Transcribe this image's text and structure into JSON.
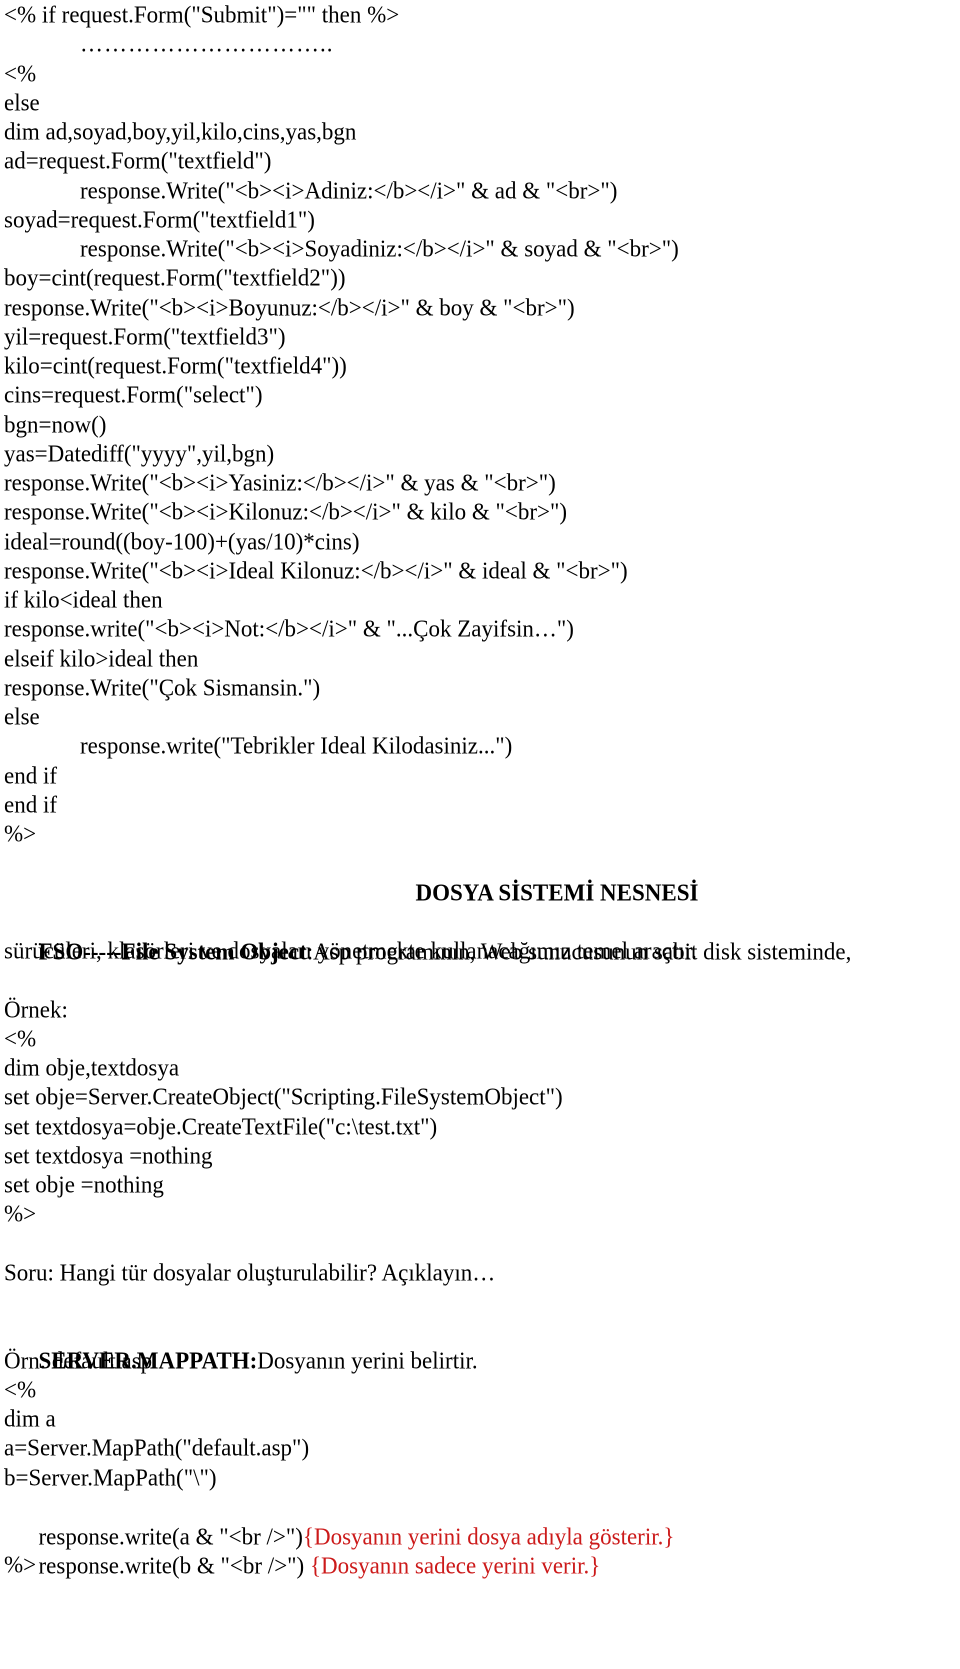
{
  "code_block_1": {
    "lines": [
      "<% if request.Form(\"Submit\")=\"\" then %>",
      "…………………………..",
      "<%",
      "else",
      "dim ad,soyad,boy,yil,kilo,cins,yas,bgn",
      "ad=request.Form(\"textfield\")",
      "response.Write(\"<b><i>Adiniz:</b></i>\" & ad & \"<br>\")",
      "soyad=request.Form(\"textfield1\")",
      "response.Write(\"<b><i>Soyadiniz:</b></i>\" & soyad & \"<br>\")",
      "boy=cint(request.Form(\"textfield2\"))",
      "response.Write(\"<b><i>Boyunuz:</b></i>\" & boy & \"<br>\")",
      "yil=request.Form(\"textfield3\")",
      "kilo=cint(request.Form(\"textfield4\"))",
      "cins=request.Form(\"select\")",
      "bgn=now()",
      "yas=Datediff(\"yyyy\",yil,bgn)",
      "response.Write(\"<b><i>Yasiniz:</b></i>\" & yas & \"<br>\")",
      "response.Write(\"<b><i>Kilonuz:</b></i>\" & kilo & \"<br>\")",
      "ideal=round((boy-100)+(yas/10)*cins)",
      "response.Write(\"<b><i>Ideal Kilonuz:</b></i>\" & ideal & \"<br>\")",
      "if kilo<ideal then",
      "response.write(\"<b><i>Not:</b></i>\" & \"...Çok Zayifsin…\")",
      "elseif kilo>ideal then",
      "response.Write(\"Çok Sismansin.\")",
      "else",
      "response.write(\"Tebrikler Ideal Kilodasiniz...\")",
      "end if",
      "end if",
      "%>"
    ]
  },
  "section_title": "DOSYA SİSTEMİ NESNESİ",
  "fso_paragraph": {
    "term": "FSO-----File System Object",
    "text": ":Asp programının, Web sunucusunun sabit disk sisteminde,",
    "text2": "sürücüleri, klasörleri ve dosyaları yönetmekte kullanacağımız temel araçtır."
  },
  "example_label": "Örnek:",
  "code_block_2": {
    "lines": [
      "<%",
      "dim obje,textdosya",
      "set obje=Server.CreateObject(\"Scripting.FileSystemObject\")",
      "set textdosya=obje.CreateTextFile(\"c:\\test.txt\")",
      "set textdosya =nothing",
      "set obje =nothing",
      "%>"
    ]
  },
  "question": "Soru: Hangi tür dosyalar oluşturulabilir? Açıklayın…",
  "mappath": {
    "term": "SERVER.MAPPATH:",
    "text": "Dosyanın yerini belirtir.",
    "example": "Örn: default.asp"
  },
  "code_block_3": {
    "lines": [
      "<%",
      "dim a",
      "a=Server.MapPath(\"default.asp\")",
      "b=Server.MapPath(\"\\\")",
      "response.write(a & \"<br />\")",
      "response.write(b & \"<br />\") ",
      "%>"
    ],
    "comments": {
      "line_a": "{Dosyanın yerini dosya adıyla gösterir.}",
      "line_b": "{Dosyanın sadece yerini verir.}"
    }
  },
  "colors": {
    "text": "#000000",
    "comment_red": "#cc1a1a",
    "background": "#ffffff"
  }
}
